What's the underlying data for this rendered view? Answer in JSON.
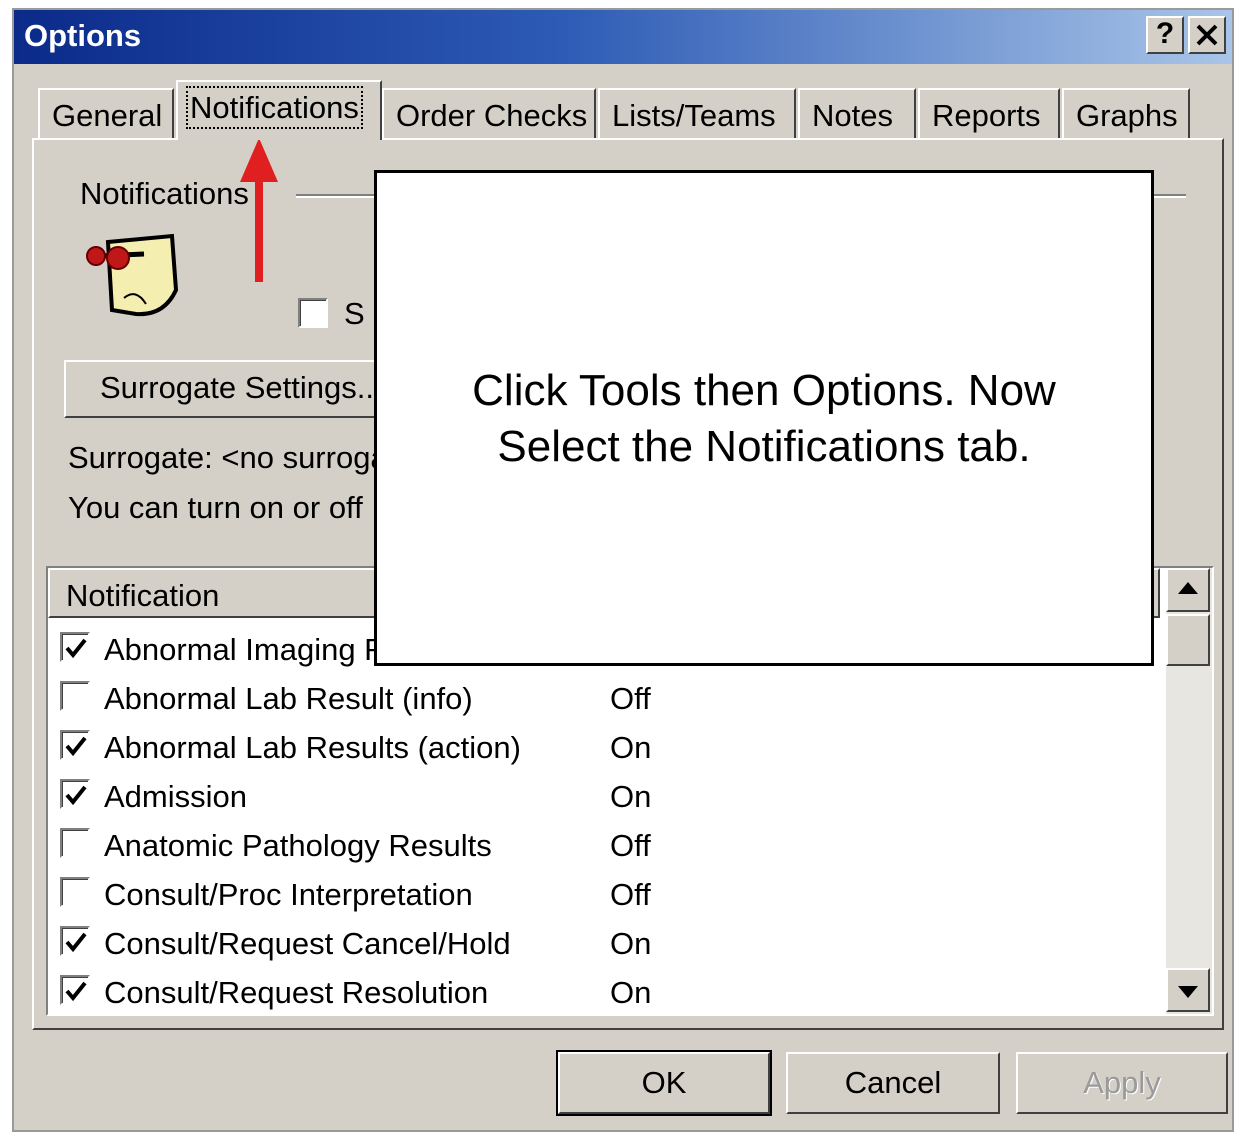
{
  "window": {
    "title": "Options",
    "help_button": "?",
    "close_button": "✕"
  },
  "tabs": [
    {
      "label": "General"
    },
    {
      "label": "Notifications"
    },
    {
      "label": "Order Checks"
    },
    {
      "label": "Lists/Teams"
    },
    {
      "label": "Notes"
    },
    {
      "label": "Reports"
    },
    {
      "label": "Graphs"
    }
  ],
  "active_tab": "Notifications",
  "notifications": {
    "group_label": "Notifications",
    "checkbox_label_partial": "S",
    "surrogate_button": "Surrogate Settings...",
    "surrogate_text": "Surrogate: <no surroga",
    "info_text": "You can turn on or off",
    "list_header": "Notification",
    "items": [
      {
        "name": "Abnormal Imaging R",
        "checked": true,
        "status": ""
      },
      {
        "name": "Abnormal Lab Result (info)",
        "checked": false,
        "status": "Off"
      },
      {
        "name": "Abnormal Lab Results (action)",
        "checked": true,
        "status": "On"
      },
      {
        "name": "Admission",
        "checked": true,
        "status": "On"
      },
      {
        "name": "Anatomic Pathology Results",
        "checked": false,
        "status": "Off"
      },
      {
        "name": "Consult/Proc Interpretation",
        "checked": false,
        "status": "Off"
      },
      {
        "name": "Consult/Request Cancel/Hold",
        "checked": true,
        "status": "On"
      },
      {
        "name": "Consult/Request Resolution",
        "checked": true,
        "status": "On"
      }
    ]
  },
  "buttons": {
    "ok": "OK",
    "cancel": "Cancel",
    "apply": "Apply"
  },
  "callout": {
    "text_line1": "Click Tools then Options. Now",
    "text_line2": "Select the Notifications tab."
  },
  "colors": {
    "title_bar_start": "#0b2a8a",
    "annotation_arrow": "#e02020",
    "dialog_face": "#d4d0c8"
  }
}
